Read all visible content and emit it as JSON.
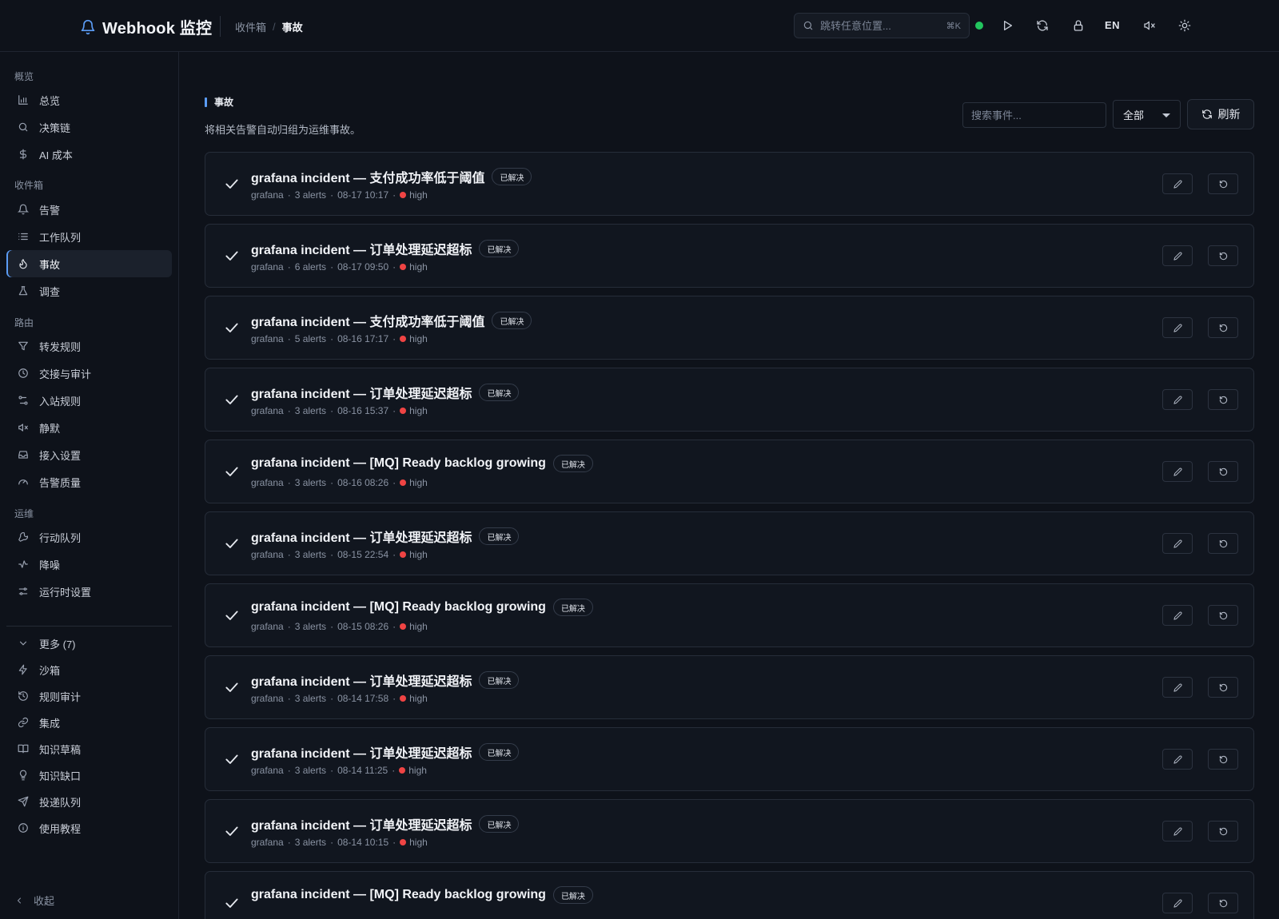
{
  "app": {
    "title": "Webhook 监控"
  },
  "breadcrumb": {
    "parent": "收件箱",
    "separator": "/",
    "current": "事故"
  },
  "header": {
    "search_placeholder": "跳转任意位置...",
    "search_shortcut": "⌘K",
    "status_color": "#22c55e",
    "lang": "EN",
    "icons": [
      "play-icon",
      "refresh-icon",
      "lock-icon",
      "mute-icon",
      "sun-icon"
    ]
  },
  "sidebar": {
    "sections": [
      {
        "label": "概览",
        "items": [
          {
            "label": "总览",
            "icon": "bar-chart-icon"
          },
          {
            "label": "决策链",
            "icon": "search-icon"
          },
          {
            "label": "AI 成本",
            "icon": "dollar-icon"
          }
        ]
      },
      {
        "label": "收件箱",
        "items": [
          {
            "label": "告警",
            "icon": "bell-icon"
          },
          {
            "label": "工作队列",
            "icon": "list-icon"
          },
          {
            "label": "事故",
            "icon": "flame-icon",
            "active": true
          },
          {
            "label": "调查",
            "icon": "flask-icon"
          }
        ]
      },
      {
        "label": "路由",
        "items": [
          {
            "label": "转发规则",
            "icon": "filter-icon"
          },
          {
            "label": "交接与审计",
            "icon": "clock-icon"
          },
          {
            "label": "入站规则",
            "icon": "route-icon"
          },
          {
            "label": "静默",
            "icon": "mute-icon"
          },
          {
            "label": "接入设置",
            "icon": "inbox-icon"
          },
          {
            "label": "告警质量",
            "icon": "gauge-icon"
          }
        ]
      },
      {
        "label": "运维",
        "items": [
          {
            "label": "行动队列",
            "icon": "wrench-icon"
          },
          {
            "label": "降噪",
            "icon": "activity-icon"
          },
          {
            "label": "运行时设置",
            "icon": "sliders-icon"
          }
        ]
      }
    ],
    "more": {
      "label": "更多 (7)",
      "icon": "chevron-down-icon"
    },
    "more_items": [
      {
        "label": "沙箱",
        "icon": "zap-icon"
      },
      {
        "label": "规则审计",
        "icon": "history-icon"
      },
      {
        "label": "集成",
        "icon": "link-icon"
      },
      {
        "label": "知识草稿",
        "icon": "book-icon"
      },
      {
        "label": "知识缺口",
        "icon": "lightbulb-icon"
      },
      {
        "label": "投递队列",
        "icon": "send-icon"
      },
      {
        "label": "使用教程",
        "icon": "info-icon"
      }
    ],
    "collapse": "收起"
  },
  "main": {
    "section": "事故",
    "subtitle": "将相关告警自动归组为运维事故。",
    "filter_placeholder": "搜索事件...",
    "filter_select": "全部",
    "refresh_label": "刷新",
    "severity_color": "#ef4444",
    "incidents": [
      {
        "title": "grafana incident — 支付成功率低于阈值",
        "status": "已解决",
        "source": "grafana",
        "alerts": "3 alerts",
        "time": "08-17 10:17",
        "severity": "high"
      },
      {
        "title": "grafana incident — 订单处理延迟超标",
        "status": "已解决",
        "source": "grafana",
        "alerts": "6 alerts",
        "time": "08-17 09:50",
        "severity": "high"
      },
      {
        "title": "grafana incident — 支付成功率低于阈值",
        "status": "已解决",
        "source": "grafana",
        "alerts": "5 alerts",
        "time": "08-16 17:17",
        "severity": "high"
      },
      {
        "title": "grafana incident — 订单处理延迟超标",
        "status": "已解决",
        "source": "grafana",
        "alerts": "3 alerts",
        "time": "08-16 15:37",
        "severity": "high"
      },
      {
        "title": "grafana incident — [MQ] Ready backlog growing",
        "status": "已解决",
        "source": "grafana",
        "alerts": "3 alerts",
        "time": "08-16 08:26",
        "severity": "high"
      },
      {
        "title": "grafana incident — 订单处理延迟超标",
        "status": "已解决",
        "source": "grafana",
        "alerts": "3 alerts",
        "time": "08-15 22:54",
        "severity": "high"
      },
      {
        "title": "grafana incident — [MQ] Ready backlog growing",
        "status": "已解决",
        "source": "grafana",
        "alerts": "3 alerts",
        "time": "08-15 08:26",
        "severity": "high"
      },
      {
        "title": "grafana incident — 订单处理延迟超标",
        "status": "已解决",
        "source": "grafana",
        "alerts": "3 alerts",
        "time": "08-14 17:58",
        "severity": "high"
      },
      {
        "title": "grafana incident — 订单处理延迟超标",
        "status": "已解决",
        "source": "grafana",
        "alerts": "3 alerts",
        "time": "08-14 11:25",
        "severity": "high"
      },
      {
        "title": "grafana incident — 订单处理延迟超标",
        "status": "已解决",
        "source": "grafana",
        "alerts": "3 alerts",
        "time": "08-14 10:15",
        "severity": "high"
      },
      {
        "title": "grafana incident — [MQ] Ready backlog growing",
        "status": "已解决",
        "source": "grafana",
        "alerts": "",
        "time": "",
        "severity": ""
      }
    ]
  }
}
